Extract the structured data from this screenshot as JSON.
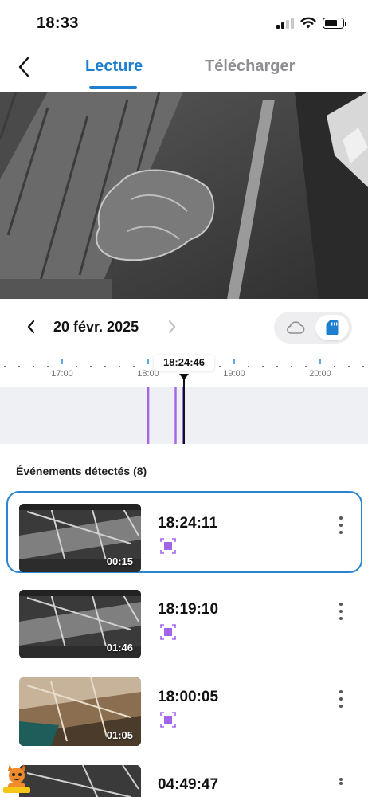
{
  "status": {
    "time": "18:33",
    "battery_level": 0.7,
    "signal_bars": 2
  },
  "nav": {
    "back_icon": "chevron-left-icon",
    "tabs": [
      {
        "label": "Lecture",
        "active": true
      },
      {
        "label": "Télécharger",
        "active": false
      }
    ]
  },
  "player": {
    "state": "playing-recording"
  },
  "date_selector": {
    "date": "20 févr. 2025",
    "prev_icon": "chevron-left-icon",
    "next_icon": "chevron-right-icon",
    "storage_options": [
      "cloud-icon",
      "sd-card-icon"
    ],
    "storage_selected": "sd-card-icon"
  },
  "timeline": {
    "current_time": "18:24:46",
    "tick_labels": [
      "17:00",
      "18:00",
      "19:00",
      "20:00"
    ],
    "event_marks": [
      "18:00:05",
      "18:19:10",
      "18:24:11"
    ]
  },
  "events": {
    "title": "Événements détectés (8)",
    "items": [
      {
        "time": "18:24:11",
        "duration": "00:15",
        "selected": true,
        "thumb": "gray"
      },
      {
        "time": "18:19:10",
        "duration": "01:46",
        "selected": false,
        "thumb": "gray"
      },
      {
        "time": "18:00:05",
        "duration": "01:05",
        "selected": false,
        "thumb": "color"
      },
      {
        "time": "04:49:47",
        "duration": "",
        "selected": false,
        "thumb": "gray"
      }
    ]
  },
  "colors": {
    "accent": "#1e7fd0",
    "motion": "#a066e6",
    "marker": "#a066e6"
  }
}
